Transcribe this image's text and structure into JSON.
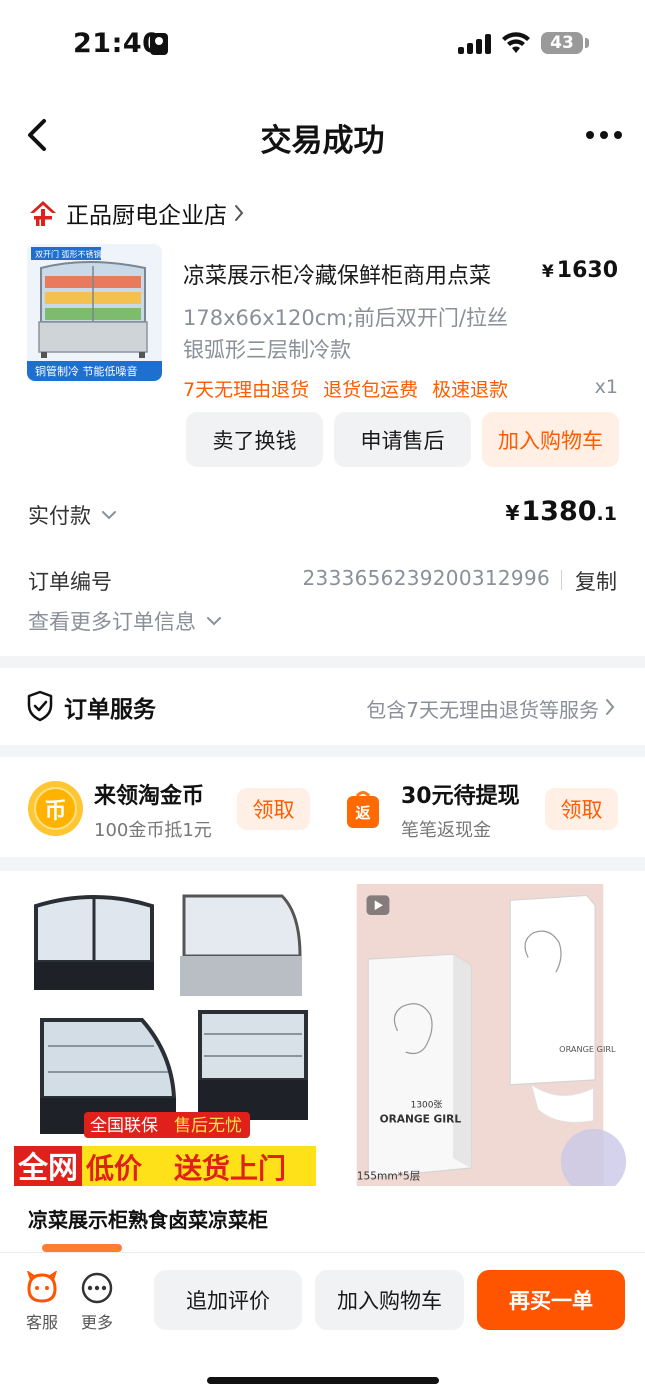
{
  "status_bar": {
    "time": "21:40",
    "battery": "43"
  },
  "nav": {
    "title": "交易成功"
  },
  "shop": {
    "name": "正品厨电企业店"
  },
  "product": {
    "title": "凉菜展示柜冷藏保鲜柜商用点菜",
    "price_currency": "¥",
    "price": "1630",
    "spec_line1": "178x66x120cm;前后双开门/拉丝",
    "spec_line2": "银弧形三层制冷款",
    "tags": [
      "7天无理由退货",
      "退货包运费",
      "极速退款"
    ],
    "quantity": "x1",
    "image_labels": {
      "top": "双开门 弧形不锈钢",
      "bottom": "铜管制冷 节能低噪音"
    },
    "buttons": {
      "sell": "卖了换钱",
      "after_sale": "申请售后",
      "add_cart": "加入购物车"
    }
  },
  "payment": {
    "label": "实付款",
    "currency": "¥",
    "amount_int": "1380",
    "amount_dec": ".1"
  },
  "order": {
    "label": "订单编号",
    "number": "2333656239200312996",
    "copy": "复制",
    "more_info": "查看更多订单信息"
  },
  "service": {
    "title": "订单服务",
    "desc": "包含7天无理由退货等服务"
  },
  "coins": {
    "title": "来领淘金币",
    "subtitle": "100金币抵1元",
    "icon_char": "币",
    "claim": "领取"
  },
  "rebate": {
    "title": "30元待提现",
    "subtitle": "笔笔返现金",
    "icon_char": "返",
    "claim": "领取"
  },
  "recommendations": [
    {
      "title": "凉菜展示柜熟食卤菜凉菜柜",
      "badge": "全国联保",
      "badge_highlight": "售后无忧",
      "banner_a": "全网",
      "banner_b": "低价",
      "banner_c": "送货上门"
    },
    {
      "brand": "ORANGE GIRL",
      "sheets": "1300张",
      "size_note": "155mm*5层"
    }
  ],
  "bottom_bar": {
    "service": "客服",
    "more": "更多",
    "review": "追加评价",
    "add_cart": "加入购物车",
    "rebuy": "再买一单"
  },
  "colors": {
    "accent": "#ff5500",
    "accent_soft": "#ffefe5",
    "muted": "#8a8f99",
    "divider": "#f3f4f6"
  }
}
